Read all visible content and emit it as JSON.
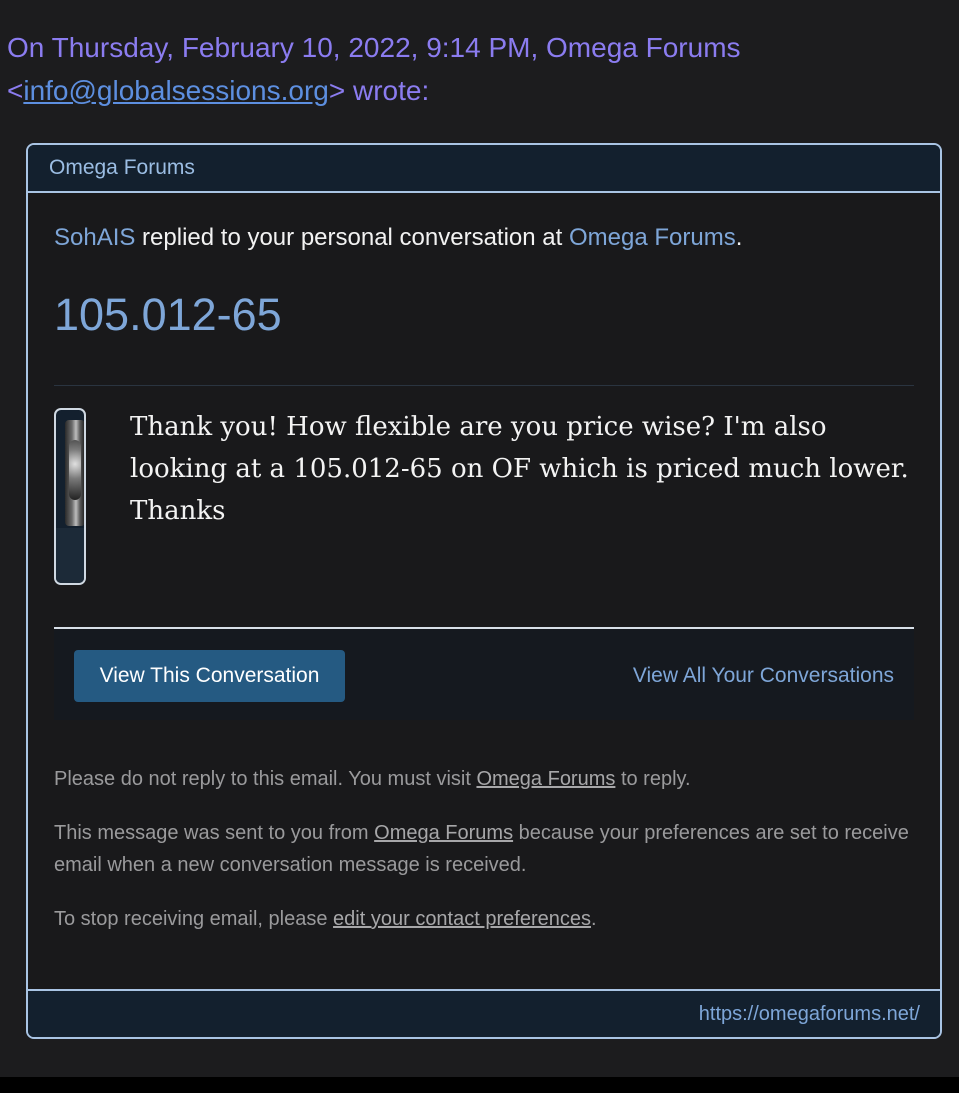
{
  "quote": {
    "prefix": "On Thursday, February 10, 2022, 9:14 PM, Omega Forums",
    "lt": "<",
    "email": "info@globalsessions.org",
    "suffix": "> wrote:"
  },
  "card": {
    "header": "Omega Forums",
    "intro": {
      "user": "SohAIS",
      "middle": " replied to your personal conversation at ",
      "site": "Omega Forums",
      "end": "."
    },
    "title": "105.012-65",
    "message": "Thank you! How flexible are you price wise? I'm also looking at a 105.012-65 on OF which is priced much lower. Thanks",
    "actions": {
      "primary": "View This Conversation",
      "secondary": "View All Your Conversations"
    },
    "notes": {
      "n1_a": "Please do not reply to this email. You must visit ",
      "n1_link": "Omega Forums",
      "n1_b": " to reply.",
      "n2_a": "This message was sent to you from ",
      "n2_link": "Omega Forums",
      "n2_b": " because your preferences are set to receive email when a new conversation message is received.",
      "n3_a": "To stop receiving email, please ",
      "n3_link": "edit your contact preferences",
      "n3_b": "."
    },
    "footer": "https://omegaforums.net/"
  },
  "colors": {
    "background": "#1c1c1e",
    "quote_text": "#8b7cf0",
    "link": "#7ea6d8",
    "button": "#255a82",
    "border": "#a9c4e4"
  }
}
